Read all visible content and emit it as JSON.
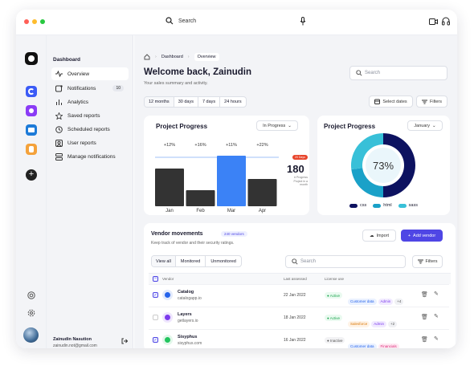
{
  "topbar": {
    "search_label": "Search"
  },
  "sidebar": {
    "section_title": "Dashboard",
    "items": [
      {
        "label": "Overview",
        "icon": "activity-icon"
      },
      {
        "label": "Notifications",
        "icon": "bell-icon",
        "badge": "10"
      },
      {
        "label": "Analytics",
        "icon": "chart-icon"
      },
      {
        "label": "Saved reports",
        "icon": "star-icon"
      },
      {
        "label": "Scheduled reports",
        "icon": "clock-icon"
      },
      {
        "label": "User reports",
        "icon": "user-square-icon"
      },
      {
        "label": "Manage notifications",
        "icon": "sliders-icon"
      }
    ],
    "user": {
      "name": "Zainudin Nasution",
      "email": "zainudin.not@gmail.com"
    }
  },
  "header": {
    "breadcrumb": [
      "Dashboard",
      "Overview"
    ],
    "title": "Welcome back, Zainudin",
    "subtitle": "Your sales summary and activity.",
    "search_placeholder": "Search",
    "ranges": [
      "12 months",
      "30 days",
      "7 days",
      "24 hours"
    ],
    "select_dates": "Select dates",
    "filters": "Filters"
  },
  "progress_card": {
    "title": "Project Progress",
    "dropdown": "In Progress",
    "kpi_badge": "20 Days",
    "kpi_value": "180",
    "kpi_caption": "# Progress Project in a month",
    "chart_data": {
      "type": "bar",
      "categories": [
        "Jan",
        "Feb",
        "Mar",
        "Apr"
      ],
      "values": [
        47,
        20,
        63,
        34
      ],
      "labels": [
        "+12%",
        "+16%",
        "+11%",
        "+22%"
      ],
      "highlight": "Mar",
      "colors": {
        "default": "#333333",
        "highlight": "#3b82f6"
      }
    }
  },
  "donut_card": {
    "title": "Project Progress",
    "dropdown": "January",
    "center_label": "73%",
    "chart_data": {
      "type": "pie",
      "categories": [
        "css",
        "html",
        "sass"
      ],
      "values": [
        50,
        23,
        27
      ],
      "colors": [
        "#0d1260",
        "#1aa1c8",
        "#38c0d8"
      ]
    }
  },
  "vendors": {
    "title": "Vendor movements",
    "count_badge": "240 vendors",
    "subtitle": "Keep track of vendor and their security ratings.",
    "import_label": "Import",
    "add_label": "Add vendor",
    "tabs": [
      "View all",
      "Monitored",
      "Unmonitored"
    ],
    "search_placeholder": "Search",
    "filters": "Filters",
    "columns": [
      "Vendor",
      "Last assessed",
      "License use"
    ],
    "rows": [
      {
        "name": "Catalog",
        "site": "catalogapp.io",
        "date": "22 Jan 2022",
        "status": "Active",
        "tags": [
          "Customer data",
          "Admin",
          "+4"
        ],
        "checked": true,
        "logo_color": "#2563eb"
      },
      {
        "name": "Layers",
        "site": "getlayers.io",
        "date": "18 Jan 2022",
        "status": "Active",
        "tags": [
          "Salesforce",
          "Admin",
          "+2"
        ],
        "checked": false,
        "logo_color": "#7c3aed"
      },
      {
        "name": "Sisyphus",
        "site": "sisyphus.com",
        "date": "16 Jan 2022",
        "status": "Inactive",
        "tags": [
          "Customer data",
          "Financials"
        ],
        "checked": true,
        "logo_color": "#22c55e"
      }
    ]
  }
}
